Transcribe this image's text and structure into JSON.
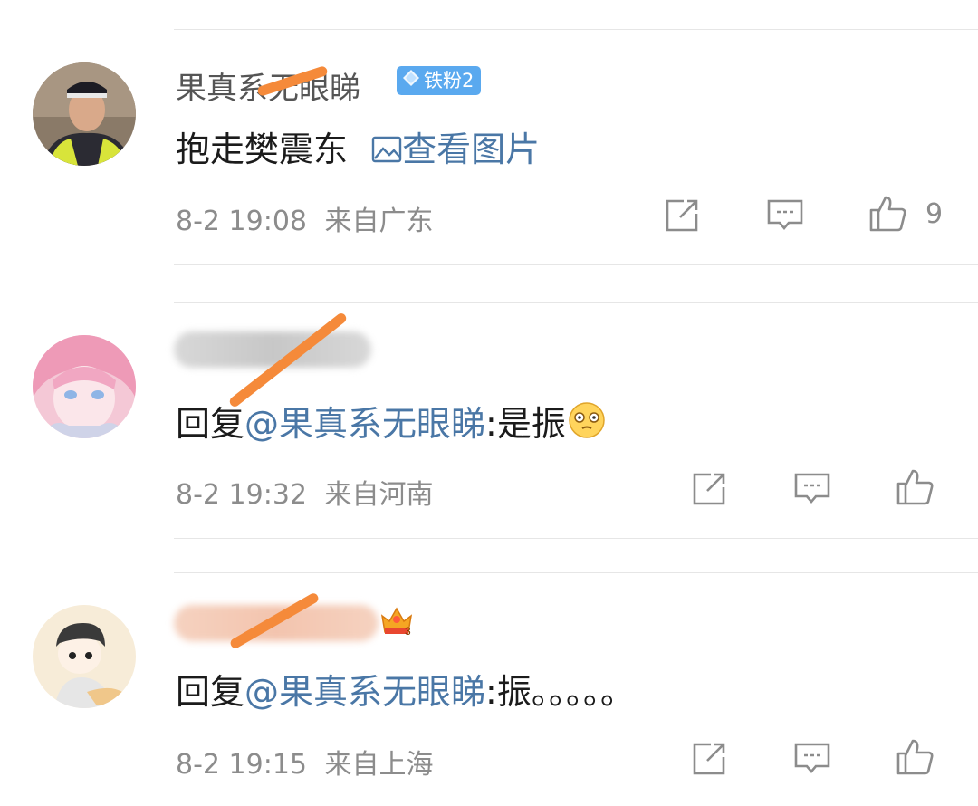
{
  "comments": [
    {
      "username": "果真系无眼睇",
      "fan_badge": "铁粉2",
      "text": "抱走樊震东",
      "image_link": "查看图片",
      "timestamp": "8-2 19:08",
      "location": "来自广东",
      "like_count": "9"
    },
    {
      "username": "",
      "reply_prefix": "回复",
      "reply_mention": "@果真系无眼睇",
      "reply_text": ":是振",
      "timestamp": "8-2 19:32",
      "location": "来自河南"
    },
    {
      "username": "",
      "reply_prefix": "回复",
      "reply_mention": "@果真系无眼睇",
      "reply_text": ":振。。。。。",
      "timestamp": "8-2 19:15",
      "location": "来自上海"
    }
  ],
  "colors": {
    "link": "#4a77a6",
    "badge": "#5aa9ef",
    "redaction_stroke": "#f58a3a",
    "meta_text": "#8c8c8c"
  },
  "icons": [
    "diamond-icon",
    "image-icon",
    "repost-icon",
    "comment-icon",
    "like-icon",
    "emoji-face-icon",
    "crown-badge-icon"
  ]
}
